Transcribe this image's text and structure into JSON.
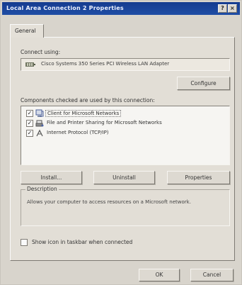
{
  "window": {
    "title": "Local Area Connection 2 Properties",
    "help_label": "?",
    "close_label": "×"
  },
  "tabs": [
    {
      "label": "General",
      "active": true
    }
  ],
  "connect_using": {
    "label": "Connect using:",
    "adapter_name": "Cisco Systems 350 Series PCI Wireless LAN Adapter",
    "configure_label": "Configure"
  },
  "components": {
    "label": "Components checked are used by this connection:",
    "items": [
      {
        "label": "Client for Microsoft Networks",
        "checked": true,
        "icon": "network-client-icon"
      },
      {
        "label": "File and Printer Sharing for Microsoft Networks",
        "checked": true,
        "icon": "printer-share-icon"
      },
      {
        "label": "Internet Protocol (TCP/IP)",
        "checked": true,
        "icon": "protocol-icon"
      }
    ],
    "install_label": "Install...",
    "uninstall_label": "Uninstall",
    "properties_label": "Properties"
  },
  "description": {
    "title": "Description",
    "text": "Allows your computer to access resources on a Microsoft network."
  },
  "taskbar_option": {
    "label": "Show icon in taskbar when connected",
    "checked": false
  },
  "footer": {
    "ok_label": "OK",
    "cancel_label": "Cancel"
  }
}
